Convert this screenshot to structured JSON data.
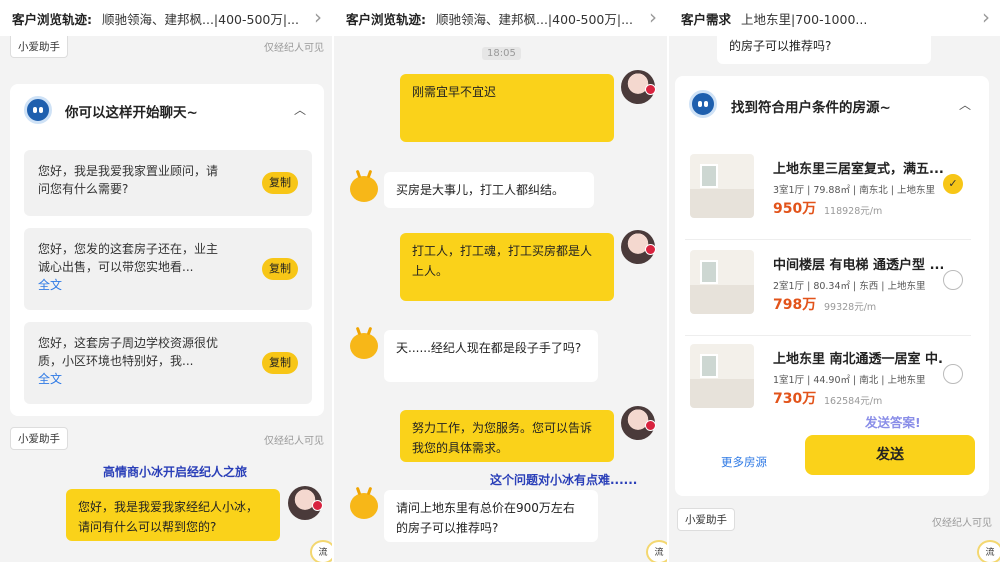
{
  "panel1": {
    "header_label": "客户浏览轨迹:",
    "header_value": "顺驰领海、建邦枫...|400-500万|...",
    "top_tag": "小爱助手",
    "top_visibility": "仅经纪人可见",
    "card_title": "你可以这样开始聊天~",
    "suggestions": [
      {
        "text": "您好，我是我爱我家置业顾问，请问您有什么需要?",
        "copy": "复制",
        "full": ""
      },
      {
        "text": "您好，您发的这套房子还在，业主诚心出售，可以带您实地看...",
        "copy": "复制",
        "full": "全文"
      },
      {
        "text": "您好，这套房子周边学校资源很优质，小区环境也特别好，我...",
        "copy": "复制",
        "full": "全文"
      }
    ],
    "bottom_tag": "小爱助手",
    "bottom_visibility": "仅经纪人可见",
    "annotation": "高情商小冰开启经纪人之旅",
    "message": "您好，我是我爱我家经纪人小冰，请问有什么可以帮到您的?",
    "corner_text": "流"
  },
  "panel2": {
    "header_label": "客户浏览轨迹:",
    "header_value": "顺驰领海、建邦枫...|400-500万|...",
    "time": "18:05",
    "messages": [
      {
        "side": "right",
        "text": "刚需宜早不宜迟"
      },
      {
        "side": "left",
        "text": "买房是大事儿，打工人都纠结。"
      },
      {
        "side": "right",
        "text": "打工人，打工魂，打工买房都是人上人。"
      },
      {
        "side": "left",
        "text": "天......经纪人现在都是段子手了吗?"
      },
      {
        "side": "right",
        "text": "努力工作，为您服务。您可以告诉我您的具体需求。"
      },
      {
        "side": "left",
        "text": "请问上地东里有总价在900万左右的房子可以推荐吗?"
      }
    ],
    "annotation": "这个问题对小冰有点难......",
    "corner_text": "流"
  },
  "panel3": {
    "header_label": "客户需求",
    "header_value": "上地东里|700-1000...",
    "top_bubble": "的房子可以推荐吗?",
    "card_title": "找到符合用户条件的房源~",
    "listings": [
      {
        "title": "上地东里三居室复式，满五...",
        "sub": "3室1厅 | 79.88㎡ | 南东北 | 上地东里",
        "price": "950万",
        "unit": "118928元/m",
        "selected": true
      },
      {
        "title": "中间楼层 有电梯 通透户型 ...",
        "sub": "2室1厅 | 80.34㎡ | 东西 | 上地东里",
        "price": "798万",
        "unit": "99328元/m",
        "selected": false
      },
      {
        "title": "上地东里 南北通透一居室 中...",
        "sub": "1室1厅 | 44.90㎡ | 南北 | 上地东里",
        "price": "730万",
        "unit": "162584元/m",
        "selected": false
      }
    ],
    "selected_mark": "✓",
    "annotation": "发送答案!",
    "more_label": "更多房源",
    "send_label": "发送",
    "bottom_tag": "小爱助手",
    "bottom_visibility": "仅经纪人可见",
    "corner_text": "流"
  }
}
